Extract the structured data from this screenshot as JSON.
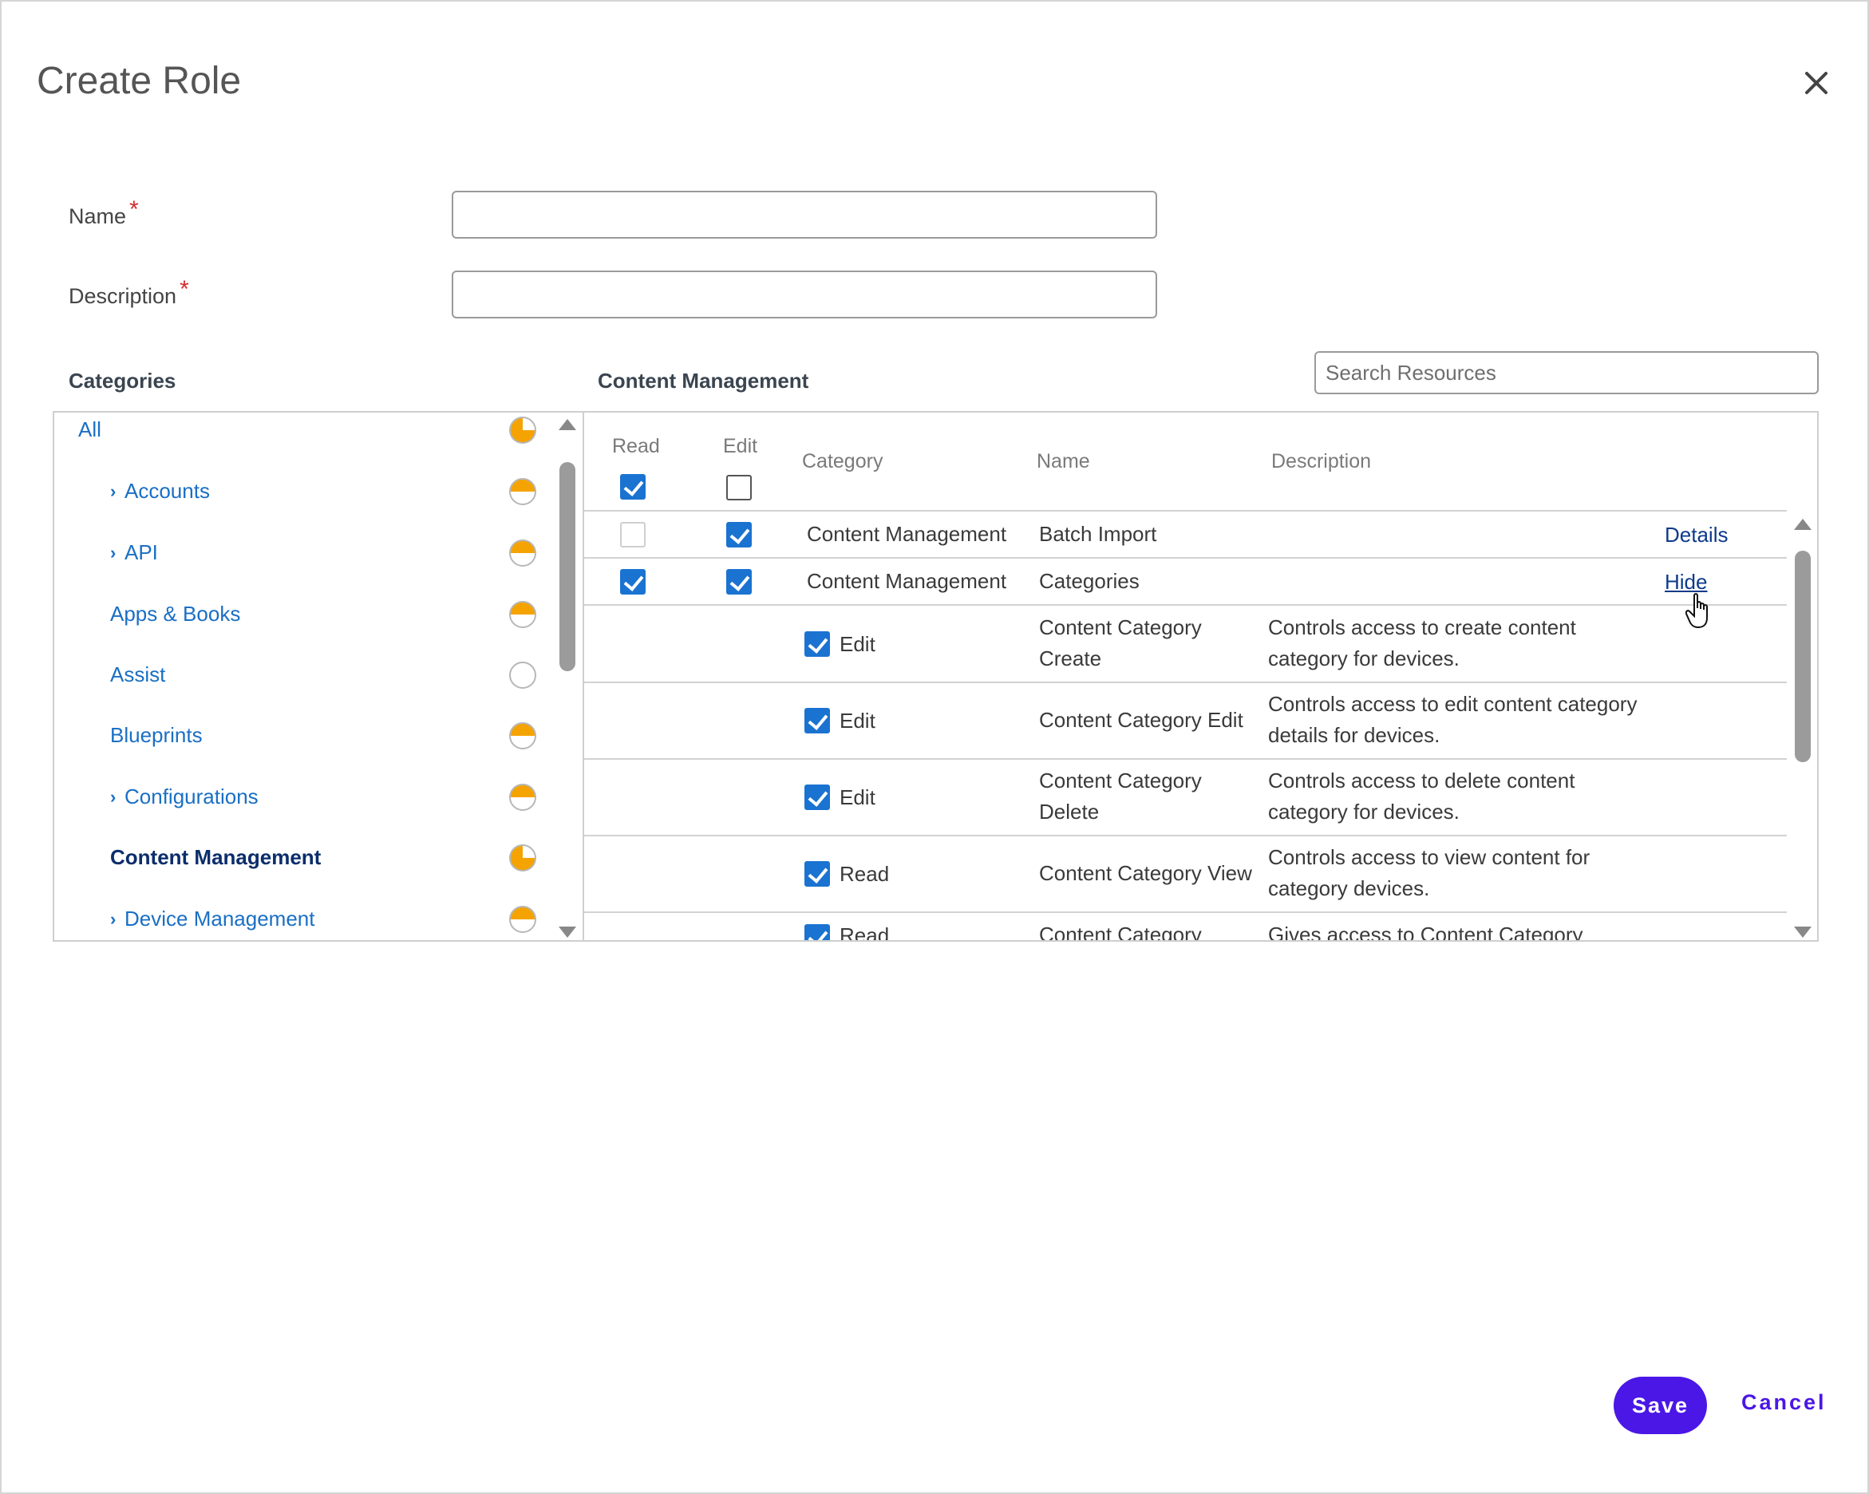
{
  "dialog": {
    "title": "Create Role",
    "close_icon": "close-icon"
  },
  "form": {
    "name_label": "Name",
    "description_label": "Description",
    "required_mark": "*",
    "name_value": "",
    "description_value": ""
  },
  "categories": {
    "heading": "Categories",
    "items": [
      {
        "label": "All",
        "expandable": false,
        "status": "three-quarter"
      },
      {
        "label": "Accounts",
        "expandable": true,
        "status": "half"
      },
      {
        "label": "API",
        "expandable": true,
        "status": "half"
      },
      {
        "label": "Apps & Books",
        "expandable": false,
        "status": "half"
      },
      {
        "label": "Assist",
        "expandable": false,
        "status": "empty"
      },
      {
        "label": "Blueprints",
        "expandable": false,
        "status": "half"
      },
      {
        "label": "Configurations",
        "expandable": true,
        "status": "half"
      },
      {
        "label": "Content Management",
        "expandable": false,
        "status": "three-quarter",
        "selected": true
      },
      {
        "label": "Device Management",
        "expandable": true,
        "status": "half"
      }
    ]
  },
  "resources": {
    "heading": "Content Management",
    "search_placeholder": "Search Resources",
    "columns": {
      "read": "Read",
      "edit": "Edit",
      "category": "Category",
      "name": "Name",
      "description": "Description"
    },
    "header_read_checked": true,
    "header_edit_checked": false,
    "rows": [
      {
        "read": "disabled",
        "edit": true,
        "category": "Content Management",
        "name": "Batch Import",
        "action": "Details"
      },
      {
        "read": true,
        "edit": true,
        "category": "Content Management",
        "name": "Categories",
        "action": "Hide"
      }
    ],
    "sub_rows": [
      {
        "checked": true,
        "perm": "Edit",
        "name_line1": "Content Category",
        "name_line2": "Create",
        "desc_line1": "Controls access to create content",
        "desc_line2": "category for devices."
      },
      {
        "checked": true,
        "perm": "Edit",
        "name_line1": "Content Category Edit",
        "name_line2": "",
        "desc_line1": "Controls access to edit content category",
        "desc_line2": "details for devices."
      },
      {
        "checked": true,
        "perm": "Edit",
        "name_line1": "Content Category",
        "name_line2": "Delete",
        "desc_line1": "Controls access to delete content",
        "desc_line2": "category for devices."
      },
      {
        "checked": true,
        "perm": "Read",
        "name_line1": "Content Category View",
        "name_line2": "",
        "desc_line1": "Controls access to view content for",
        "desc_line2": "category devices."
      },
      {
        "checked": true,
        "perm": "Read",
        "name_line1": "Content Category",
        "name_line2": "",
        "desc_line1": "Gives access to Content Category",
        "desc_line2": ""
      }
    ]
  },
  "footer": {
    "save_label": "Save",
    "cancel_label": "Cancel"
  },
  "colors": {
    "primary": "#4a17e6",
    "link": "#1a6fc4",
    "checkbox": "#1a73d1",
    "status_pie": "#f5a300"
  }
}
